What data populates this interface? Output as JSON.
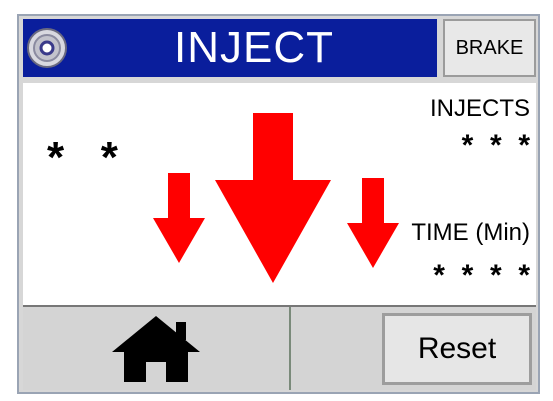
{
  "header": {
    "title": "INJECT",
    "brake_label": "BRAKE",
    "logo_icon": "dial-icon"
  },
  "content": {
    "left_value": "*   *",
    "injects_label": "INJECTS",
    "injects_value": "*  *  *",
    "time_label": "TIME (Min)",
    "time_value": "*  *  *  *",
    "arrow_color": "#ff0000",
    "arrow_icons": [
      "arrow-down-icon",
      "arrow-down-icon",
      "arrow-down-icon"
    ]
  },
  "footer": {
    "home_icon": "home-icon",
    "reset_label": "Reset"
  },
  "colors": {
    "title_bg": "#0a1e9c",
    "title_text": "#ffffff",
    "panel_bg": "#d7d7d7"
  }
}
